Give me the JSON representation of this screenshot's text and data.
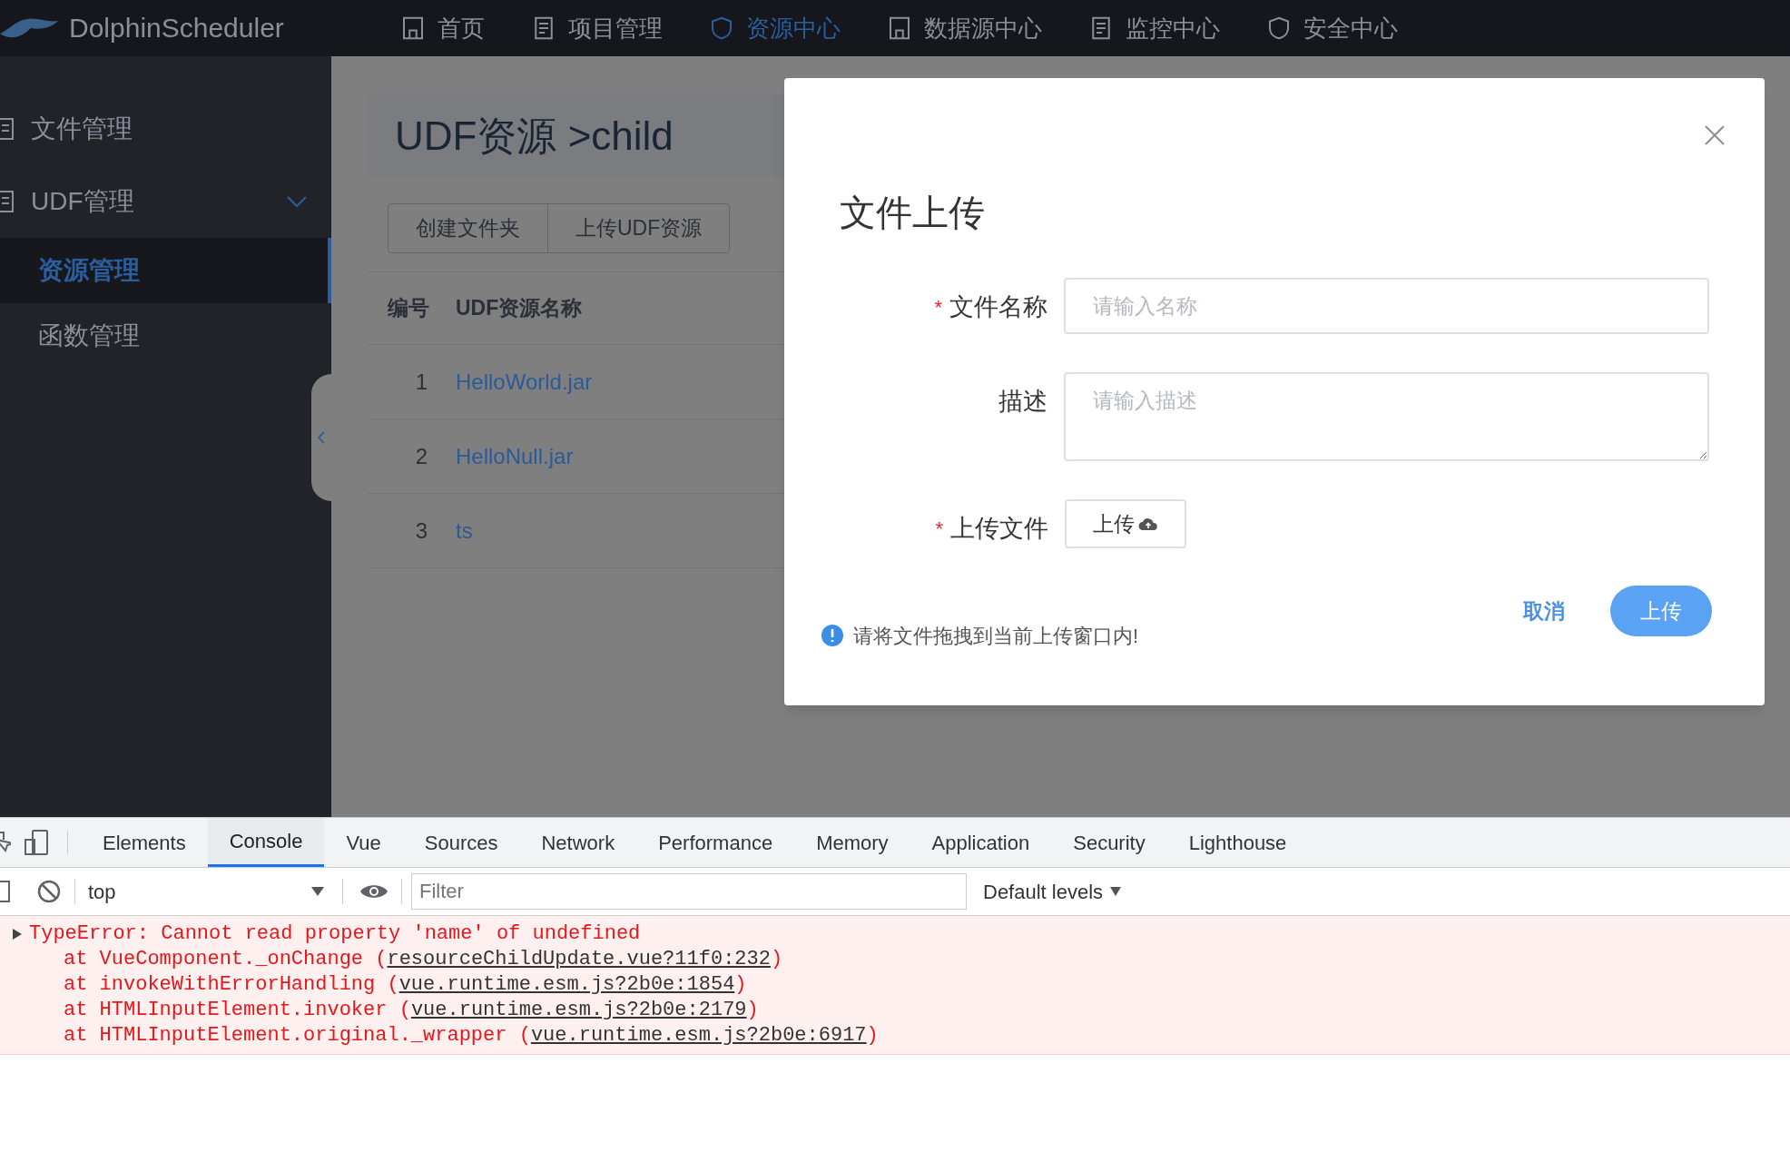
{
  "top_nav": {
    "logo_text": "DolphinScheduler",
    "items": [
      {
        "label": "首页",
        "selected": false
      },
      {
        "label": "项目管理",
        "selected": false
      },
      {
        "label": "资源中心",
        "selected": true
      },
      {
        "label": "数据源中心",
        "selected": false
      },
      {
        "label": "监控中心",
        "selected": false
      },
      {
        "label": "安全中心",
        "selected": false
      }
    ]
  },
  "sidebar": {
    "items": [
      {
        "kind": "link",
        "label": "文件管理",
        "selected": false
      },
      {
        "kind": "group",
        "label": "UDF管理",
        "selected": false,
        "expanded": true,
        "children": [
          {
            "label": "资源管理",
            "selected": true
          },
          {
            "label": "函数管理",
            "selected": false
          }
        ]
      }
    ]
  },
  "main": {
    "title": "UDF资源 >child",
    "buttons": [
      "创建文件夹",
      "上传UDF资源"
    ],
    "table": {
      "columns": [
        "编号",
        "UDF资源名称"
      ],
      "rows": [
        {
          "cells": [
            "1",
            "HelloWorld.jar"
          ]
        },
        {
          "cells": [
            "2",
            "HelloNull.jar"
          ]
        },
        {
          "cells": [
            "3",
            "ts"
          ]
        }
      ]
    }
  },
  "modal": {
    "title": "文件上传",
    "required_mark": "*",
    "fields": [
      {
        "kind": "input",
        "label": "文件名称",
        "required": true,
        "placeholder": "请输入名称"
      },
      {
        "kind": "textarea",
        "label": "描述",
        "required": false,
        "placeholder": "请输入描述"
      },
      {
        "kind": "upload",
        "label": "上传文件",
        "required": true,
        "button_label": "上传"
      }
    ],
    "hint": "请将文件拖拽到当前上传窗口内!",
    "cancel": "取消",
    "confirm": "上传"
  },
  "devtools": {
    "tabs": [
      {
        "label": "Elements",
        "selected": false
      },
      {
        "label": "Console",
        "selected": true
      },
      {
        "label": "Vue",
        "selected": false
      },
      {
        "label": "Sources",
        "selected": false
      },
      {
        "label": "Network",
        "selected": false
      },
      {
        "label": "Performance",
        "selected": false
      },
      {
        "label": "Memory",
        "selected": false
      },
      {
        "label": "Application",
        "selected": false
      },
      {
        "label": "Security",
        "selected": false
      },
      {
        "label": "Lighthouse",
        "selected": false
      }
    ],
    "context": "top",
    "filter_placeholder": "Filter",
    "levels": "Default levels",
    "error": {
      "message": "TypeError: Cannot read property 'name' of undefined",
      "stack": [
        {
          "text": "at VueComponent._onChange (",
          "link": "resourceChildUpdate.vue?11f0:232",
          "end": ")"
        },
        {
          "text": "at invokeWithErrorHandling (",
          "link": "vue.runtime.esm.js?2b0e:1854",
          "end": ")"
        },
        {
          "text": "at HTMLInputElement.invoker (",
          "link": "vue.runtime.esm.js?2b0e:2179",
          "end": ")"
        },
        {
          "text": "at HTMLInputElement.original._wrapper (",
          "link": "vue.runtime.esm.js?2b0e:6917",
          "end": ")"
        }
      ]
    }
  }
}
